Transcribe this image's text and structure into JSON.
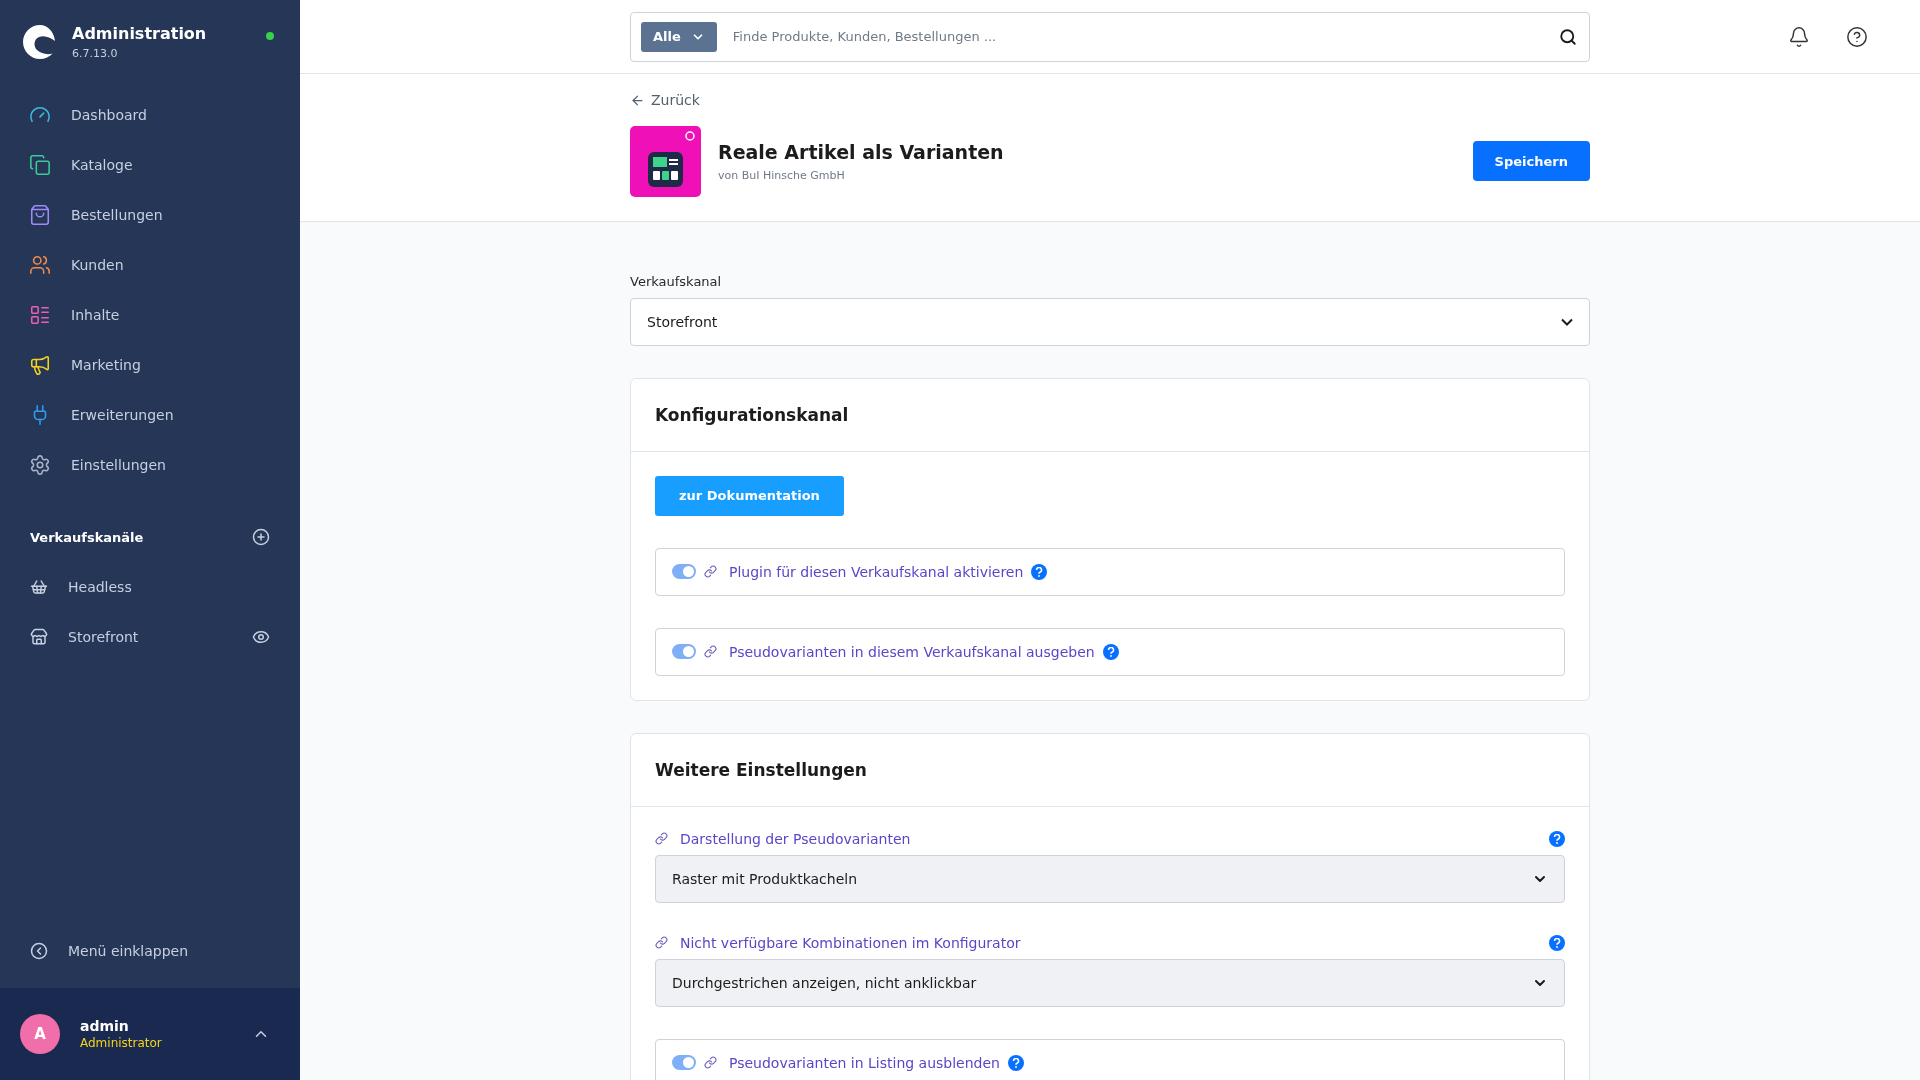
{
  "sidebar": {
    "brand": {
      "title": "Administration",
      "version": "6.7.13.0",
      "online": true
    },
    "nav": [
      {
        "label": "Dashboard",
        "kind": "dashboard",
        "color": "#3fb8e0"
      },
      {
        "label": "Kataloge",
        "kind": "catalog",
        "color": "#3ec99a"
      },
      {
        "label": "Bestellungen",
        "kind": "orders",
        "color": "#9d8cf7"
      },
      {
        "label": "Kunden",
        "kind": "customers",
        "color": "#f0894a"
      },
      {
        "label": "Inhalte",
        "kind": "content",
        "color": "#e95fb3"
      },
      {
        "label": "Marketing",
        "kind": "marketing",
        "color": "#f5d31a"
      },
      {
        "label": "Erweiterungen",
        "kind": "extensions",
        "color": "#2f9cf0"
      },
      {
        "label": "Einstellungen",
        "kind": "settings",
        "color": "#a9b4c8"
      }
    ],
    "channels_heading": "Verkaufskanäle",
    "channels": [
      {
        "label": "Headless",
        "kind": "basket",
        "preview": false
      },
      {
        "label": "Storefront",
        "kind": "store",
        "preview": true
      }
    ],
    "collapse": "Menü einklappen",
    "user": {
      "initial": "A",
      "name": "admin",
      "role": "Administrator"
    }
  },
  "search": {
    "filter": "Alle",
    "placeholder": "Finde Produkte, Kunden, Bestellungen ..."
  },
  "back": "Zurück",
  "plugin": {
    "name": "Reale Artikel als Varianten",
    "vendor": "von BuI Hinsche GmbH"
  },
  "save": "Speichern",
  "sales_channel": {
    "label": "Verkaufskanal",
    "value": "Storefront"
  },
  "cards": [
    {
      "title": "Konfigurationskanal",
      "button": "zur Dokumentation",
      "fields": [
        {
          "kind": "toggle",
          "label": "Plugin für diesen Verkaufskanal aktivieren",
          "on": true
        },
        {
          "kind": "toggle",
          "label": "Pseudovarianten in diesem Verkaufskanal ausgeben",
          "on": true
        }
      ]
    },
    {
      "title": "Weitere Einstellungen",
      "fields": [
        {
          "kind": "select",
          "label": "Darstellung der Pseudovarianten",
          "value": "Raster mit Produktkacheln"
        },
        {
          "kind": "select",
          "label": "Nicht verfügbare Kombinationen im Konfigurator",
          "value": "Durchgestrichen anzeigen, nicht anklickbar"
        },
        {
          "kind": "toggle",
          "label": "Pseudovarianten in Listing ausblenden",
          "on": true
        }
      ]
    }
  ]
}
